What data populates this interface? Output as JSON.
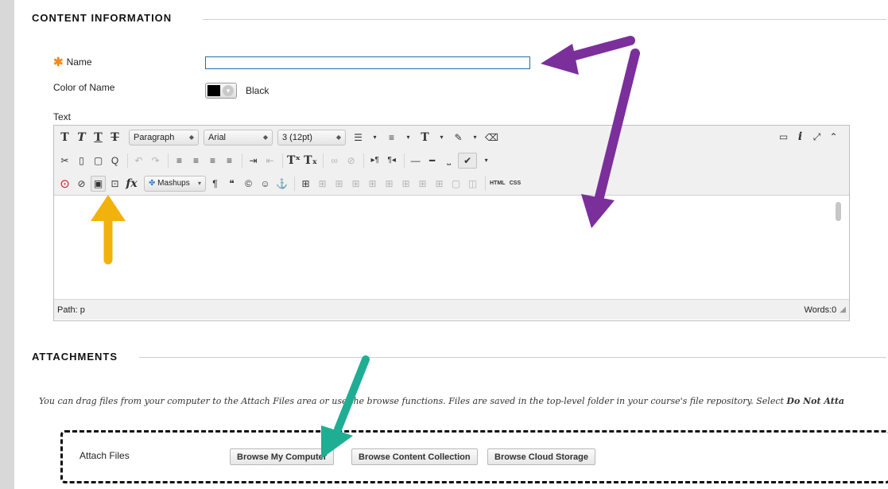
{
  "content_section": {
    "title": "CONTENT INFORMATION",
    "name_label": "Name",
    "name_value": "",
    "required_star": "✱",
    "color_label": "Color of Name",
    "color_value": "Black",
    "text_label": "Text"
  },
  "editor": {
    "paragraph_select": "Paragraph",
    "font_select": "Arial",
    "size_select": "3 (12pt)",
    "mashups_label": "Mashups",
    "html_label": "HTML",
    "css_label": "CSS",
    "path_label": "Path: p",
    "words_label": "Words:0"
  },
  "attachments_section": {
    "title": "ATTACHMENTS",
    "instructions_prefix": "You can drag files from your computer to the Attach Files area or use the browse functions. Files are saved in the top-level folder in your course's file repository.  Select ",
    "instructions_bold": "Do Not Atta",
    "attach_label": "Attach Files",
    "buttons": [
      "Browse My Computer",
      "Browse Content Collection",
      "Browse Cloud Storage"
    ]
  },
  "colors": {
    "purple_arrow": "#7b2f9b",
    "yellow_arrow": "#f2b20d",
    "teal_arrow": "#1fae93",
    "required_star": "#f08c1e",
    "input_border": "#1f6fb2"
  }
}
